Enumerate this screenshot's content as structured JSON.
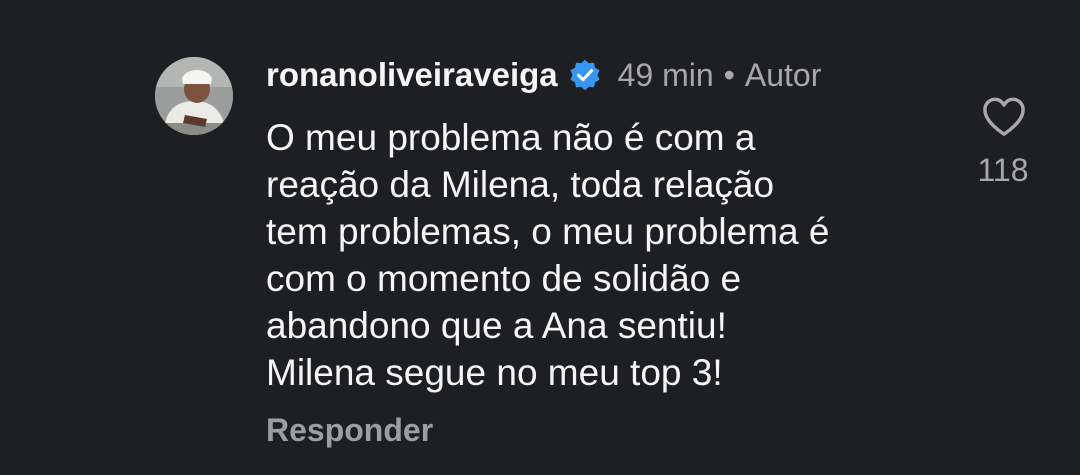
{
  "comment": {
    "username": "ronanoliveiraveiga",
    "verified_icon": "verified-badge-icon",
    "time_ago": "49 min",
    "separator": "•",
    "author_label": "Autor",
    "text_lines": [
      "O meu problema não é com a",
      "reação da Milena, toda relação",
      "tem problemas, o meu problema é",
      "com o momento de solidão e",
      "abandono que a Ana sentiu!",
      "Milena segue no meu top 3!"
    ],
    "reply_label": "Responder",
    "like_icon": "heart-outline-icon",
    "like_count": "118"
  },
  "colors": {
    "background": "#1e1f23",
    "text_primary": "#f5f5f5",
    "text_secondary": "#a8a8ab",
    "verified_blue": "#3797f0"
  }
}
